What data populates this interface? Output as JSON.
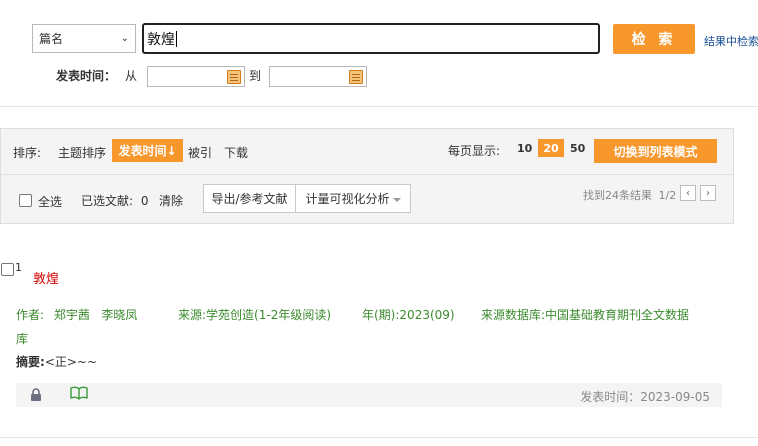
{
  "search": {
    "field_selected": "篇名",
    "query": "敦煌",
    "button_label": "检 索",
    "search_within_label": "结果中检索"
  },
  "date_filter": {
    "label": "发表时间：",
    "from_label": "从",
    "from_value": "",
    "to_label": "到",
    "to_value": ""
  },
  "sort": {
    "label": "排序:",
    "options": [
      "主题排序",
      "发表时间↓",
      "被引",
      "下载"
    ],
    "active_index": 1
  },
  "per_page": {
    "label": "每页显示:",
    "options": [
      "10",
      "20",
      "50"
    ],
    "active": "20"
  },
  "switch_view_label": "切换到列表模式",
  "selection": {
    "select_all_label": "全选",
    "selected_label": "已选文献:",
    "selected_count": "0",
    "clear_label": "清除",
    "export_label": "导出/参考文献",
    "analysis_label": "计量可视化分析"
  },
  "results_info": {
    "found_text": "找到24条结果",
    "page_text": "1/2",
    "prev_icon": "chevron-left-icon",
    "next_icon": "chevron-right-icon"
  },
  "results": [
    {
      "index": "1",
      "title": "敦煌",
      "author_label": "作者:",
      "authors": "郑宇茜   李晓凤",
      "source_label": "来源:",
      "source": "学苑创造(1-2年级阅读)",
      "issue_label": "年(期):",
      "issue": "2023(09)",
      "database_label": "来源数据库:",
      "database_line1": "中国基础教育期刊全文数据",
      "database_line2": "库",
      "abstract_label": "摘要:",
      "abstract": "<正>~~",
      "pub_time": "发表时间：2023-09-05"
    }
  ],
  "colors": {
    "accent": "#f8972b",
    "title_red": "#d40000",
    "meta_green": "#3b8a2e",
    "link_blue": "#1a4f95"
  }
}
